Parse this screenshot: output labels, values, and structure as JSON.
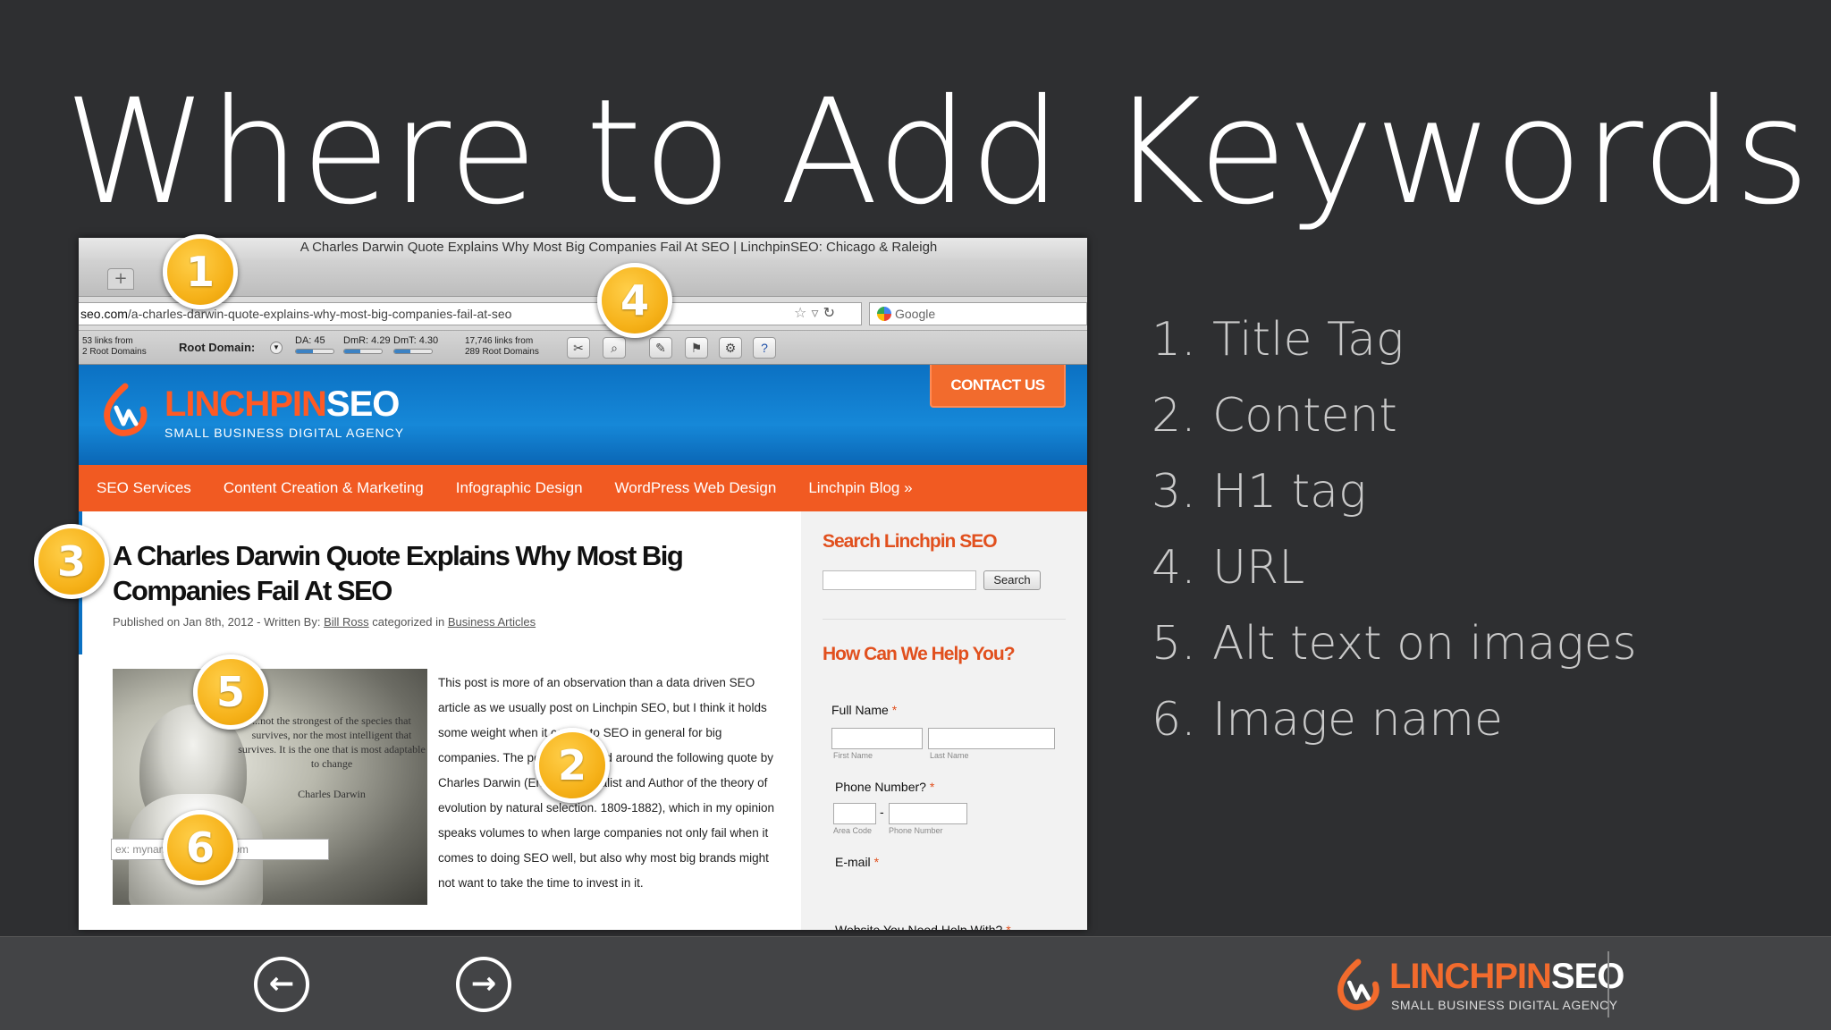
{
  "slide": {
    "title": "Where to Add Keywords",
    "keywords": [
      {
        "num": "1.",
        "label": "Title Tag"
      },
      {
        "num": "2.",
        "label": "Content"
      },
      {
        "num": "3.",
        "label": "H1 tag"
      },
      {
        "num": "4.",
        "label": "URL"
      },
      {
        "num": "5.",
        "label": "Alt text on images"
      },
      {
        "num": "6.",
        "label": "Image name"
      }
    ],
    "badges": [
      "1",
      "2",
      "3",
      "4",
      "5",
      "6"
    ]
  },
  "browser": {
    "window_title": "A Charles Darwin Quote Explains Why Most Big Companies Fail At SEO | LinchpinSEO: Chicago & Raleigh",
    "new_tab": "+",
    "url_domain": "seo.com",
    "url_path": "/a-charles-darwin-quote-explains-why-most-big-companies-fail-at-seo",
    "search_placeholder": "Google",
    "toolbar": {
      "links_line1": "53 links from",
      "links_line2": "2 Root Domains",
      "root_domain": "Root Domain:",
      "da": "DA: 45",
      "dmr": "DmR: 4.29",
      "dmt": "DmT: 4.30",
      "links2_line1": "17,746 links from",
      "links2_line2": "289 Root Domains",
      "metric_fill": [
        0.45,
        0.43,
        0.43
      ]
    }
  },
  "site": {
    "logo_a": "LINCHPIN",
    "logo_b": "SEO",
    "tagline": "SMALL BUSINESS DIGITAL AGENCY",
    "contact": "CONTACT US",
    "nav": [
      "SEO Services",
      "Content Creation & Marketing",
      "Infographic Design",
      "WordPress Web Design",
      "Linchpin Blog »"
    ],
    "article_title": "A Charles Darwin Quote Explains Why Most Big Companies Fail At SEO",
    "byline_pre": "Published on Jan 8th, 2012 - Written By: ",
    "byline_author": "Bill Ross",
    "byline_mid": " categorized in ",
    "byline_cat": "Business Articles",
    "quote": "...not the strongest of the species that survives, nor the most intelligent that survives. It is the one that is most adaptable to change",
    "quote_author": "Charles Darwin",
    "body": "This post is more of an observation than a data driven SEO article as we usually post on Linchpin SEO, but I think it holds some weight when it comes to SEO in general for big companies. The post is centered around the following quote by Charles Darwin (English Naturalist and Author of the theory of evolution by natural selection. 1809-1882), which in my opinion speaks volumes to when large companies not only fail when it comes to doing SEO well, but also why most big brands might not want to take the time to invest in it.",
    "sidebar": {
      "search_heading": "Search Linchpin SEO",
      "search_button": "Search",
      "help_heading": "How Can We Help You?",
      "full_name": "Full Name",
      "first_name": "First Name",
      "last_name": "Last Name",
      "phone": "Phone Number?",
      "area_code": "Area Code",
      "phone_number": "Phone Number",
      "email": "E-mail",
      "email_placeholder": "ex: myname@example.com",
      "website_help": "Website You Need Help With?",
      "required": "*"
    }
  },
  "footer": {
    "logo_a": "LINCHPIN",
    "logo_b": "SEO",
    "tagline": "SMALL BUSINESS DIGITAL AGENCY",
    "prev_icon": "arrow-left-circle",
    "next_icon": "arrow-right-circle"
  },
  "colors": {
    "background": "#2e2f31",
    "accent_orange": "#f15a22",
    "header_blue": "#0b71c3",
    "badge_gold": "#f6b21a"
  }
}
